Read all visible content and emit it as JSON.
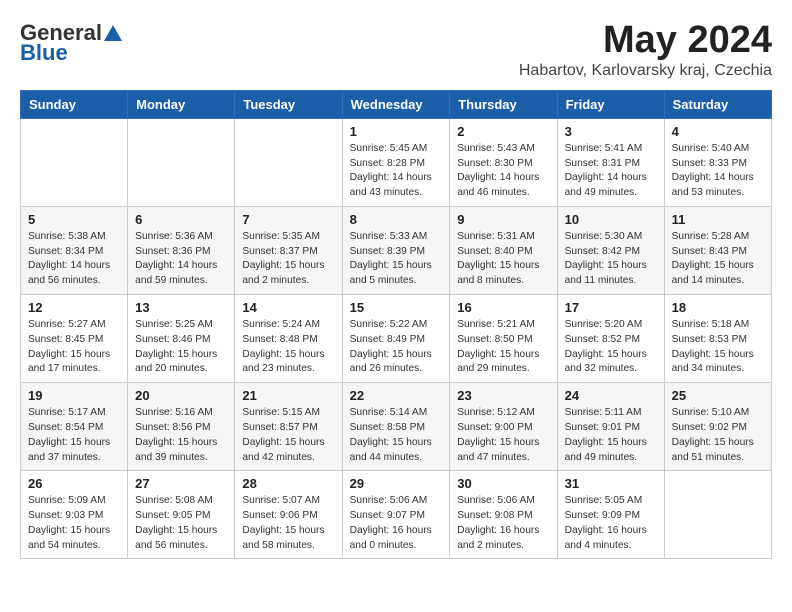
{
  "header": {
    "logo_general": "General",
    "logo_blue": "Blue",
    "month": "May 2024",
    "location": "Habartov, Karlovarsky kraj, Czechia"
  },
  "weekdays": [
    "Sunday",
    "Monday",
    "Tuesday",
    "Wednesday",
    "Thursday",
    "Friday",
    "Saturday"
  ],
  "weeks": [
    [
      {
        "day": "",
        "info": ""
      },
      {
        "day": "",
        "info": ""
      },
      {
        "day": "",
        "info": ""
      },
      {
        "day": "1",
        "info": "Sunrise: 5:45 AM\nSunset: 8:28 PM\nDaylight: 14 hours\nand 43 minutes."
      },
      {
        "day": "2",
        "info": "Sunrise: 5:43 AM\nSunset: 8:30 PM\nDaylight: 14 hours\nand 46 minutes."
      },
      {
        "day": "3",
        "info": "Sunrise: 5:41 AM\nSunset: 8:31 PM\nDaylight: 14 hours\nand 49 minutes."
      },
      {
        "day": "4",
        "info": "Sunrise: 5:40 AM\nSunset: 8:33 PM\nDaylight: 14 hours\nand 53 minutes."
      }
    ],
    [
      {
        "day": "5",
        "info": "Sunrise: 5:38 AM\nSunset: 8:34 PM\nDaylight: 14 hours\nand 56 minutes."
      },
      {
        "day": "6",
        "info": "Sunrise: 5:36 AM\nSunset: 8:36 PM\nDaylight: 14 hours\nand 59 minutes."
      },
      {
        "day": "7",
        "info": "Sunrise: 5:35 AM\nSunset: 8:37 PM\nDaylight: 15 hours\nand 2 minutes."
      },
      {
        "day": "8",
        "info": "Sunrise: 5:33 AM\nSunset: 8:39 PM\nDaylight: 15 hours\nand 5 minutes."
      },
      {
        "day": "9",
        "info": "Sunrise: 5:31 AM\nSunset: 8:40 PM\nDaylight: 15 hours\nand 8 minutes."
      },
      {
        "day": "10",
        "info": "Sunrise: 5:30 AM\nSunset: 8:42 PM\nDaylight: 15 hours\nand 11 minutes."
      },
      {
        "day": "11",
        "info": "Sunrise: 5:28 AM\nSunset: 8:43 PM\nDaylight: 15 hours\nand 14 minutes."
      }
    ],
    [
      {
        "day": "12",
        "info": "Sunrise: 5:27 AM\nSunset: 8:45 PM\nDaylight: 15 hours\nand 17 minutes."
      },
      {
        "day": "13",
        "info": "Sunrise: 5:25 AM\nSunset: 8:46 PM\nDaylight: 15 hours\nand 20 minutes."
      },
      {
        "day": "14",
        "info": "Sunrise: 5:24 AM\nSunset: 8:48 PM\nDaylight: 15 hours\nand 23 minutes."
      },
      {
        "day": "15",
        "info": "Sunrise: 5:22 AM\nSunset: 8:49 PM\nDaylight: 15 hours\nand 26 minutes."
      },
      {
        "day": "16",
        "info": "Sunrise: 5:21 AM\nSunset: 8:50 PM\nDaylight: 15 hours\nand 29 minutes."
      },
      {
        "day": "17",
        "info": "Sunrise: 5:20 AM\nSunset: 8:52 PM\nDaylight: 15 hours\nand 32 minutes."
      },
      {
        "day": "18",
        "info": "Sunrise: 5:18 AM\nSunset: 8:53 PM\nDaylight: 15 hours\nand 34 minutes."
      }
    ],
    [
      {
        "day": "19",
        "info": "Sunrise: 5:17 AM\nSunset: 8:54 PM\nDaylight: 15 hours\nand 37 minutes."
      },
      {
        "day": "20",
        "info": "Sunrise: 5:16 AM\nSunset: 8:56 PM\nDaylight: 15 hours\nand 39 minutes."
      },
      {
        "day": "21",
        "info": "Sunrise: 5:15 AM\nSunset: 8:57 PM\nDaylight: 15 hours\nand 42 minutes."
      },
      {
        "day": "22",
        "info": "Sunrise: 5:14 AM\nSunset: 8:58 PM\nDaylight: 15 hours\nand 44 minutes."
      },
      {
        "day": "23",
        "info": "Sunrise: 5:12 AM\nSunset: 9:00 PM\nDaylight: 15 hours\nand 47 minutes."
      },
      {
        "day": "24",
        "info": "Sunrise: 5:11 AM\nSunset: 9:01 PM\nDaylight: 15 hours\nand 49 minutes."
      },
      {
        "day": "25",
        "info": "Sunrise: 5:10 AM\nSunset: 9:02 PM\nDaylight: 15 hours\nand 51 minutes."
      }
    ],
    [
      {
        "day": "26",
        "info": "Sunrise: 5:09 AM\nSunset: 9:03 PM\nDaylight: 15 hours\nand 54 minutes."
      },
      {
        "day": "27",
        "info": "Sunrise: 5:08 AM\nSunset: 9:05 PM\nDaylight: 15 hours\nand 56 minutes."
      },
      {
        "day": "28",
        "info": "Sunrise: 5:07 AM\nSunset: 9:06 PM\nDaylight: 15 hours\nand 58 minutes."
      },
      {
        "day": "29",
        "info": "Sunrise: 5:06 AM\nSunset: 9:07 PM\nDaylight: 16 hours\nand 0 minutes."
      },
      {
        "day": "30",
        "info": "Sunrise: 5:06 AM\nSunset: 9:08 PM\nDaylight: 16 hours\nand 2 minutes."
      },
      {
        "day": "31",
        "info": "Sunrise: 5:05 AM\nSunset: 9:09 PM\nDaylight: 16 hours\nand 4 minutes."
      },
      {
        "day": "",
        "info": ""
      }
    ]
  ]
}
